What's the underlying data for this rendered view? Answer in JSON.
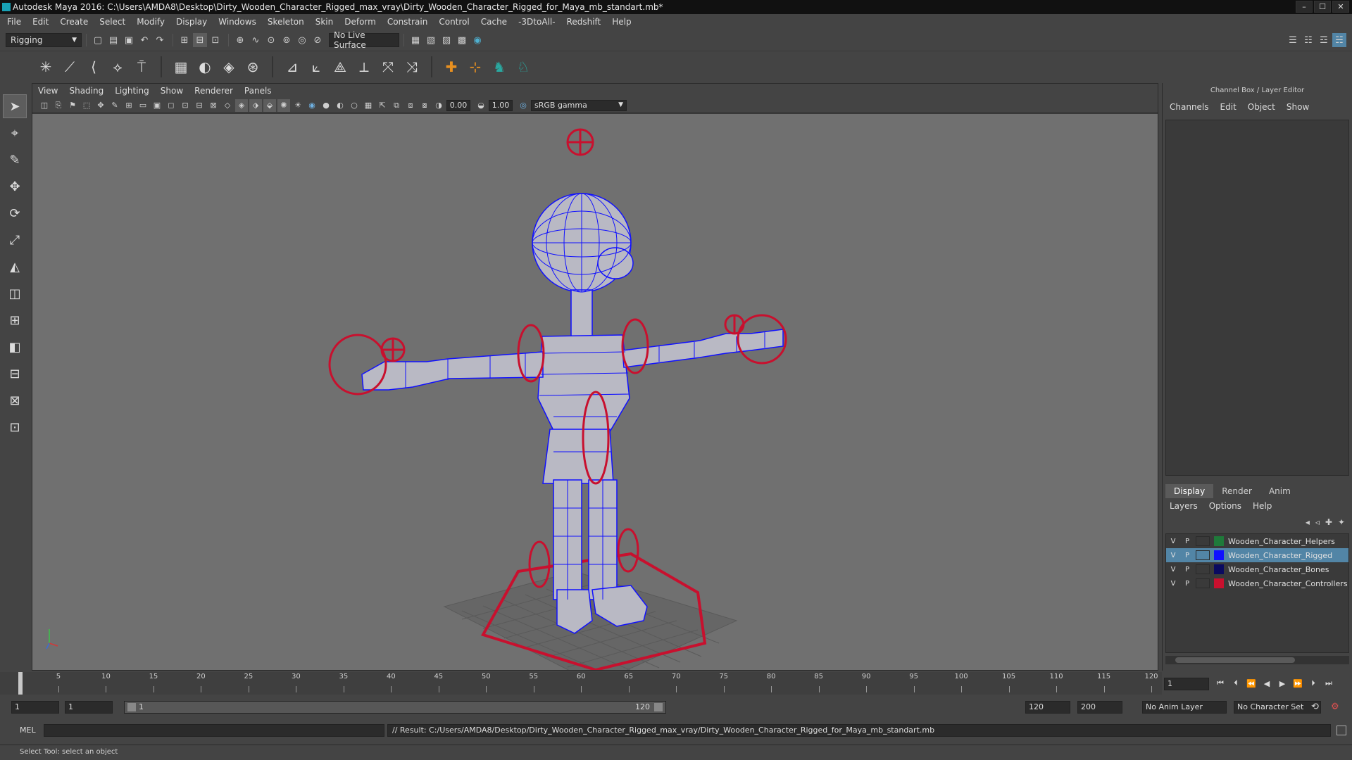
{
  "window": {
    "title": "Autodesk Maya 2016: C:\\Users\\AMDA8\\Desktop\\Dirty_Wooden_Character_Rigged_max_vray\\Dirty_Wooden_Character_Rigged_for_Maya_mb_standart.mb*",
    "controls": [
      "–",
      "☐",
      "✕"
    ]
  },
  "menubar": [
    "File",
    "Edit",
    "Create",
    "Select",
    "Modify",
    "Display",
    "Windows",
    "Skeleton",
    "Skin",
    "Deform",
    "Constrain",
    "Control",
    "Cache",
    "-3DtoAll-",
    "Redshift",
    "Help"
  ],
  "statusline": {
    "menuset": "Rigging",
    "live_surface": "No Live Surface"
  },
  "viewport": {
    "menus": [
      "View",
      "Shading",
      "Lighting",
      "Show",
      "Renderer",
      "Panels"
    ],
    "exposure": "0.00",
    "gamma": "1.00",
    "color_space": "sRGB gamma",
    "camera": "persp",
    "colors": {
      "mesh": "#1010ff",
      "controls": "#c8102e",
      "grid": "#5a5a5a",
      "background": "#707070"
    }
  },
  "channelbox": {
    "title": "Channel Box / Layer Editor",
    "menus": [
      "Channels",
      "Edit",
      "Object",
      "Show"
    ]
  },
  "layers": {
    "tabs": [
      "Display",
      "Render",
      "Anim"
    ],
    "active_tab": "Display",
    "menus": [
      "Layers",
      "Options",
      "Help"
    ],
    "items": [
      {
        "v": "V",
        "p": "P",
        "name": "Wooden_Character_Helpers",
        "color": "#1f7a3a",
        "selected": false
      },
      {
        "v": "V",
        "p": "P",
        "name": "Wooden_Character_Rigged",
        "color": "#1010ff",
        "selected": true
      },
      {
        "v": "V",
        "p": "P",
        "name": "Wooden_Character_Bones",
        "color": "#0a0a60",
        "selected": false
      },
      {
        "v": "V",
        "p": "P",
        "name": "Wooden_Character_Controllers",
        "color": "#c8102e",
        "selected": false
      }
    ]
  },
  "timeline": {
    "ticks": [
      "1",
      "5",
      "10",
      "15",
      "20",
      "25",
      "30",
      "35",
      "40",
      "45",
      "50",
      "55",
      "60",
      "65",
      "70",
      "75",
      "80",
      "85",
      "90",
      "95",
      "100",
      "105",
      "110",
      "115",
      "120"
    ],
    "current_frame": "1"
  },
  "range": {
    "start_field": "1",
    "playback_start": "1",
    "slider_start": "1",
    "slider_end": "120",
    "playback_end": "120",
    "end_field": "200",
    "anim_layer": "No Anim Layer",
    "character_set": "No Character Set"
  },
  "cmdline": {
    "label": "MEL",
    "result": "// Result: C:/Users/AMDA8/Desktop/Dirty_Wooden_Character_Rigged_max_vray/Dirty_Wooden_Character_Rigged_for_Maya_mb_standart.mb"
  },
  "helpline": "Select Tool: select an object"
}
